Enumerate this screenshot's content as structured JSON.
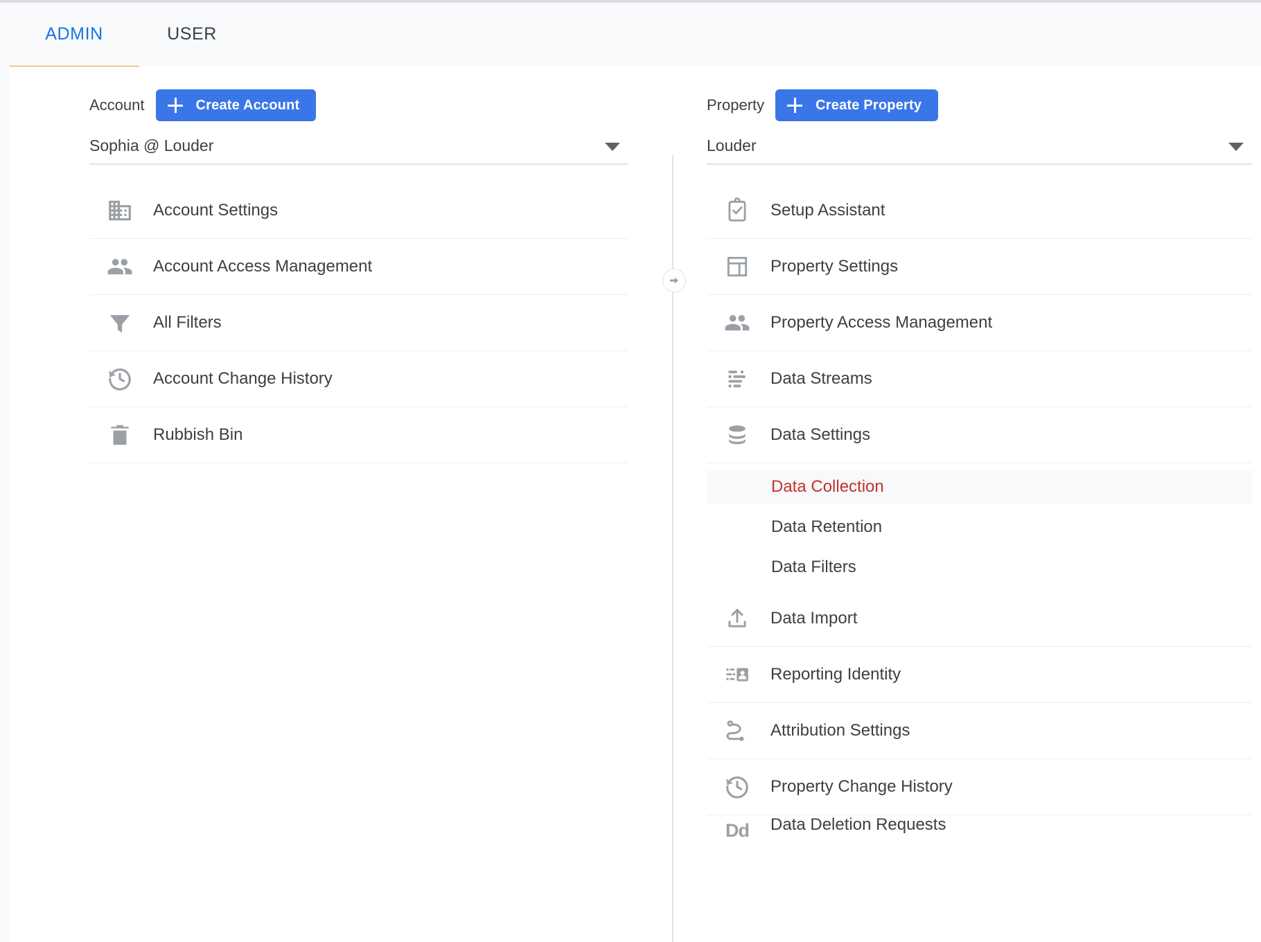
{
  "tabs": [
    {
      "id": "admin",
      "label": "ADMIN",
      "active": true
    },
    {
      "id": "user",
      "label": "USER",
      "active": false
    }
  ],
  "colors": {
    "accent_blue": "#3b76e8",
    "tab_active_text": "#1a73e8",
    "tab_underline": "#ed9a34",
    "selected_item_text": "#c5312b",
    "selected_item_bg": "#f7f9fa",
    "icon_grey": "#9aa0a6",
    "text_primary": "#3c4043",
    "divider": "#eceef0"
  },
  "account_column": {
    "label": "Account",
    "create_button_label": "Create Account",
    "create_button_icon": "plus-icon",
    "selector_value": "Sophia @ Louder",
    "selector_caret_icon": "chevron-down-icon",
    "items": [
      {
        "id": "account-settings",
        "label": "Account Settings",
        "icon": "building-icon"
      },
      {
        "id": "account-access-management",
        "label": "Account Access Management",
        "icon": "people-icon"
      },
      {
        "id": "all-filters",
        "label": "All Filters",
        "icon": "funnel-icon"
      },
      {
        "id": "account-change-history",
        "label": "Account Change History",
        "icon": "history-icon"
      },
      {
        "id": "rubbish-bin",
        "label": "Rubbish Bin",
        "icon": "trash-icon"
      }
    ]
  },
  "property_column": {
    "label": "Property",
    "create_button_label": "Create Property",
    "create_button_icon": "plus-icon",
    "selector_value": "Louder",
    "selector_caret_icon": "chevron-down-icon",
    "items": [
      {
        "id": "setup-assistant",
        "label": "Setup Assistant",
        "icon": "clipboard-check-icon"
      },
      {
        "id": "property-settings",
        "label": "Property Settings",
        "icon": "layout-icon"
      },
      {
        "id": "property-access-management",
        "label": "Property Access Management",
        "icon": "people-icon"
      },
      {
        "id": "data-streams",
        "label": "Data Streams",
        "icon": "data-streams-icon"
      },
      {
        "id": "data-settings",
        "label": "Data Settings",
        "icon": "database-icon"
      },
      {
        "id": "data-import",
        "label": "Data Import",
        "icon": "upload-icon"
      },
      {
        "id": "reporting-identity",
        "label": "Reporting Identity",
        "icon": "reporting-identity-icon"
      },
      {
        "id": "attribution-settings",
        "label": "Attribution Settings",
        "icon": "attribution-icon"
      },
      {
        "id": "property-change-history",
        "label": "Property Change History",
        "icon": "history-icon"
      },
      {
        "id": "data-deletion-requests",
        "label": "Data Deletion Requests",
        "icon": "dd-icon",
        "icon_text": "Dd"
      }
    ],
    "data_settings_subitems": [
      {
        "id": "data-collection",
        "label": "Data Collection",
        "selected": true
      },
      {
        "id": "data-retention",
        "label": "Data Retention",
        "selected": false
      },
      {
        "id": "data-filters",
        "label": "Data Filters",
        "selected": false
      }
    ]
  },
  "divider": {
    "knob_icon": "arrow-right-circle-icon"
  }
}
